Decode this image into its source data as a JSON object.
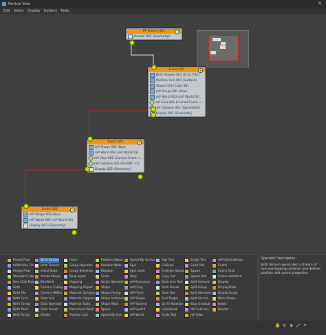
{
  "window": {
    "title": "Particle View",
    "close_glyph": "✕"
  },
  "menu": [
    "Edit",
    "Select",
    "Display",
    "Options",
    "Tools"
  ],
  "nodes": {
    "source": {
      "title": "PF Source 001",
      "rows": [
        {
          "label": "Render 001 (Geometry)",
          "kind": "disp"
        }
      ]
    },
    "event001": {
      "title": "Event 001",
      "rows": [
        {
          "label": "Birth Stream 001 (0-32 T:61)",
          "kind": "op"
        },
        {
          "label": "Position Icon 001 (Surface)",
          "kind": "op"
        },
        {
          "label": "Shape 001 (Cube 3D)",
          "kind": "op"
        },
        {
          "label": "mP Shape 001 (Box)",
          "kind": "op"
        },
        {
          "label": "mP World 003 (mP World 02)",
          "kind": "op"
        },
        {
          "label": "mP Glue 001 (Current Event +...",
          "kind": "test"
        },
        {
          "label": "mP Collision 001 (Sphere001)",
          "kind": "test"
        },
        {
          "label": "Display 001 (Geometry)",
          "kind": "disp"
        }
      ]
    },
    "event002": {
      "title": "Event 002",
      "rows": [
        {
          "label": "mP Shape 002 (Box)",
          "kind": "op"
        },
        {
          "label": "mP World 004 (mP World 02)",
          "kind": "op"
        },
        {
          "label": "mP Glue 002 (Current Event +...",
          "kind": "test"
        },
        {
          "label": "mP Collision 002 (Box001 +1)",
          "kind": "test"
        },
        {
          "label": "Display 002 (Geometry)",
          "kind": "disp"
        }
      ]
    },
    "event003": {
      "title": "Event 003",
      "rows": [
        {
          "label": "mP Shape 003 (Box)",
          "kind": "op"
        },
        {
          "label": "mP World 005 (mP World 02)",
          "kind": "op"
        },
        {
          "label": "Display 003 (Geometry)",
          "kind": "disp"
        }
      ]
    }
  },
  "depot": {
    "columns": [
      [
        "Preset Flow",
        "mParticles Flow",
        "Empty Flow",
        "Standard Flow",
        "One Click Flow",
        "Birth",
        "Birth File",
        "Birth Grid",
        "Birth Group",
        "Birth Paint",
        "Birth Script"
      ],
      [
        "Birth Stream",
        "Birth Texture",
        "Initial State",
        "Arnold Shape",
        "BlurWind",
        "Camera Culling",
        "Camera IMBlur",
        "Data Icon",
        "Data Operator",
        "Data Preset",
        "Delete"
      ],
      [
        "Force",
        "Group Operator",
        "Group Selection",
        "Keep Apart",
        "Mapping",
        "Mapping Object",
        "Material Dynamic",
        "Material Frequency",
        "Material Static",
        "Placement Paint",
        "Position Icon"
      ],
      [
        "Position Object",
        "Random Walk",
        "Rotation",
        "Scale",
        "Script Operator",
        "Shape",
        "Shape Facing",
        "Shape Instance",
        "Shape Mark",
        "Speed",
        "Speed By Icon"
      ],
      [
        "Speed By Surface",
        "Spin",
        "Spin Limit",
        "Stop",
        "mP Buoyancy",
        "mP Drag",
        "mP Force",
        "mP Shape",
        "mP Solvent",
        "mP Switch",
        "mP World"
      ],
      [
        "Age Test",
        "Collision",
        "Collision Spawn",
        "Copy Out",
        "Data Icon Test",
        "Data Preset",
        "Data Test",
        "Find Target",
        "Go To Rotation",
        "Lock/Bond",
        "Scale Test"
      ],
      [
        "Script Test",
        "Send Out",
        "Spawn",
        "Speed Test",
        "Split Amount",
        "Split Group",
        "Split Selected",
        "Split Source",
        "Stop Gradual",
        "mP Collision",
        "mP Glue"
      ],
      [
        "mP InterCollision",
        "Cache",
        "Cache Disk",
        "Cache Selective",
        "Display",
        "DisplayData",
        "DisplayScript",
        "Mark Shape",
        "Notes",
        "Render"
      ]
    ],
    "selected": "Birth Stream"
  },
  "description": {
    "heading": "Operator Description:",
    "text": "Birth Stream generates a stream of non-overlapping particles and defines position and speed properties."
  }
}
